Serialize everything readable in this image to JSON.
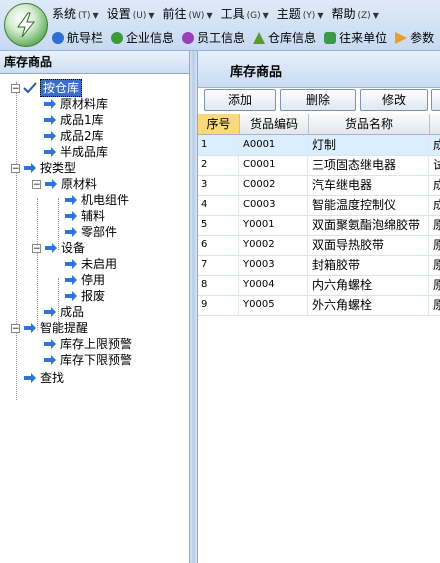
{
  "menubar": {
    "items": [
      {
        "label": "系统",
        "hotkey": "(T)"
      },
      {
        "label": "设置",
        "hotkey": "(U)"
      },
      {
        "label": "前往",
        "hotkey": "(W)"
      },
      {
        "label": "工具",
        "hotkey": "(G)"
      },
      {
        "label": "主题",
        "hotkey": "(Y)"
      },
      {
        "label": "帮助",
        "hotkey": "(Z)"
      }
    ]
  },
  "toolbar": {
    "items": [
      {
        "label": "航导栏",
        "icon": "navigation-icon",
        "color": "#2f6fd0"
      },
      {
        "label": "企业信息",
        "icon": "company-icon",
        "color": "#3d9a3a"
      },
      {
        "label": "员工信息",
        "icon": "employee-icon",
        "color": "#9a3fb8"
      },
      {
        "label": "仓库信息",
        "icon": "warehouse-icon",
        "color": "#5a9a2f"
      },
      {
        "label": "往来单位",
        "icon": "partner-icon",
        "color": "#3a9a4a"
      },
      {
        "label": "参数",
        "icon": "parameter-icon",
        "color": "#e8a020"
      }
    ]
  },
  "left_panel": {
    "title": "库存商品",
    "tree": [
      {
        "label": "按仓库",
        "selected": true
      },
      {
        "label": "原材料库"
      },
      {
        "label": "成品1库"
      },
      {
        "label": "成品2库"
      },
      {
        "label": "半成品库"
      },
      {
        "label": "按类型"
      },
      {
        "label": "原材料"
      },
      {
        "label": "机电组件"
      },
      {
        "label": "辅料"
      },
      {
        "label": "零部件"
      },
      {
        "label": "设备"
      },
      {
        "label": "未启用"
      },
      {
        "label": "停用"
      },
      {
        "label": "报废"
      },
      {
        "label": "成品"
      },
      {
        "label": "智能提醒"
      },
      {
        "label": "库存上限预警"
      },
      {
        "label": "库存下限预警"
      },
      {
        "label": "查找"
      }
    ]
  },
  "right_panel": {
    "title": "库存商品",
    "buttons": {
      "add": "添加",
      "delete": "删除",
      "edit": "修改"
    },
    "columns": {
      "seq": "序号",
      "code": "货品编码",
      "name": "货品名称",
      "extra": ""
    },
    "rows": [
      {
        "seq": "1",
        "code": "A0001",
        "name": "灯制",
        "extra": "成"
      },
      {
        "seq": "2",
        "code": "C0001",
        "name": "三项固态继电器",
        "extra": "试"
      },
      {
        "seq": "3",
        "code": "C0002",
        "name": "汽车继电器",
        "extra": "成"
      },
      {
        "seq": "4",
        "code": "C0003",
        "name": "智能温度控制仪",
        "extra": "成"
      },
      {
        "seq": "5",
        "code": "Y0001",
        "name": "双面聚氨酯泡绵胶带",
        "extra": "原"
      },
      {
        "seq": "6",
        "code": "Y0002",
        "name": "双面导热胶带",
        "extra": "原"
      },
      {
        "seq": "7",
        "code": "Y0003",
        "name": "封箱胶带",
        "extra": "原"
      },
      {
        "seq": "8",
        "code": "Y0004",
        "name": "内六角螺栓",
        "extra": "原"
      },
      {
        "seq": "9",
        "code": "Y0005",
        "name": "外六角螺栓",
        "extra": "原"
      }
    ]
  }
}
